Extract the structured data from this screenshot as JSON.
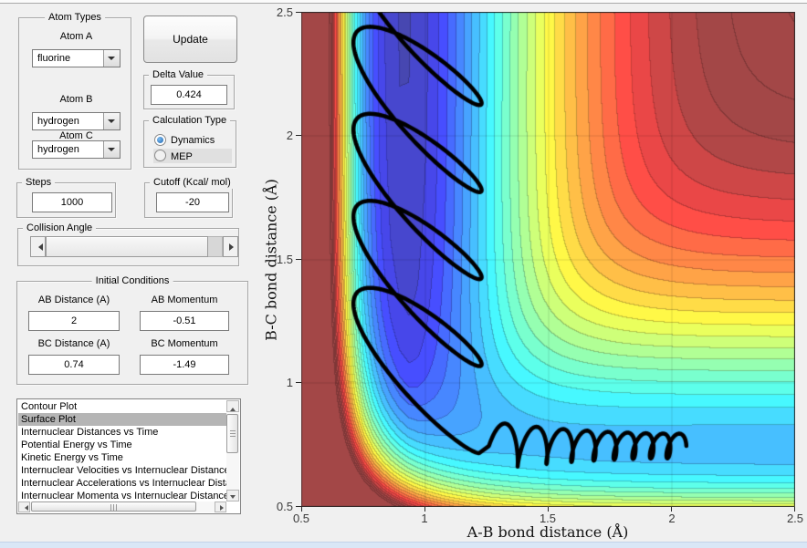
{
  "atom_types": {
    "title": "Atom Types",
    "a_label": "Atom A",
    "a_value": "fluorine",
    "b_label": "Atom B",
    "b_value": "hydrogen",
    "c_label": "Atom C",
    "c_value": "hydrogen"
  },
  "update": {
    "label": "Update"
  },
  "delta": {
    "title": "Delta Value",
    "value": "0.424"
  },
  "calc": {
    "title": "Calculation Type",
    "dynamics_label": "Dynamics",
    "mep_label": "MEP",
    "selected": "Dynamics"
  },
  "steps": {
    "title": "Steps",
    "value": "1000"
  },
  "cutoff": {
    "title": "Cutoff (Kcal/ mol)",
    "value": "-20"
  },
  "collision": {
    "title": "Collision Angle"
  },
  "init": {
    "title": "Initial Conditions",
    "ab_d_label": "AB Distance (A)",
    "ab_d_value": "2",
    "ab_m_label": "AB Momentum",
    "ab_m_value": "-0.51",
    "bc_d_label": "BC Distance (A)",
    "bc_d_value": "0.74",
    "bc_m_label": "BC Momentum",
    "bc_m_value": "-1.49"
  },
  "plot_list": {
    "selected_index": 1,
    "items": [
      "Contour Plot",
      "Surface Plot",
      "Internuclear Distances vs Time",
      "Potential Energy vs Time",
      "Kinetic Energy vs Time",
      "Internuclear Velocities vs Internuclear Distance",
      "Internuclear Accelerations vs Internuclear Distance",
      "Internuclear Momenta vs Internuclear Distance"
    ]
  },
  "chart_data": {
    "type": "heatmap",
    "subtype": "filled-contour-potential-energy-surface",
    "title": "",
    "xlabel": "A-B bond distance (Å)",
    "ylabel": "B-C bond distance (Å)",
    "xlim": [
      0.5,
      2.5
    ],
    "ylim": [
      0.5,
      2.5
    ],
    "x_ticks": [
      "0.5",
      "1",
      "1.5",
      "2",
      "2.5"
    ],
    "y_ticks": [
      "2.5",
      "2",
      "1.5",
      "1",
      "0.5"
    ],
    "grid": true,
    "colormap": "jet",
    "levels": 26,
    "surface_model": {
      "description": "Collinear LEPS potential for F + H-H (kcal/mol), AB = F-H on x, BC = H-H on y, AC = x+y",
      "pairs": [
        {
          "D": 141.196,
          "beta": 2.2187,
          "re": 0.917,
          "sato": 0.167
        },
        {
          "D": 109.49,
          "beta": 1.942,
          "re": 0.7419,
          "sato": 0.106
        },
        {
          "D": 141.196,
          "beta": 2.2187,
          "re": 0.917,
          "sato": 0.167
        }
      ],
      "well": {
        "depth": 2.2,
        "x": 0.94,
        "y": 1.08,
        "sx": 0.004,
        "sy": 0.12
      },
      "vmin": -145,
      "vmax": -20,
      "grid_n": 56,
      "white_blend": 0.28,
      "line_darken": 0.78
    },
    "trajectory": {
      "color": "#000000",
      "width": 4.5,
      "start_ab": 2.0,
      "start_bc": 0.74,
      "entrance": {
        "x_start": 2.04,
        "x_end": 1.28,
        "y0": 0.745,
        "amp0": 0.05,
        "amp1": 0.095,
        "cycles_a": 12.0,
        "cycles_b": 3.5,
        "x_wobble": 0.022
      },
      "product": {
        "cx": 0.97,
        "ax": 0.26,
        "y_start": 0.95,
        "y_drift": 1.62,
        "ay": 0.24,
        "loops": 4.6,
        "phase0": 0.28,
        "skew": 0.5
      }
    }
  }
}
